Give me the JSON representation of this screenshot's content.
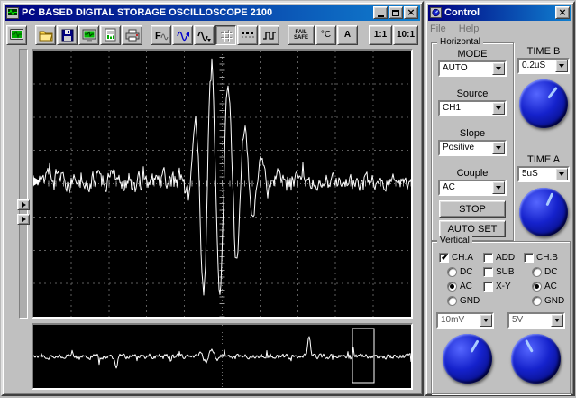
{
  "colors": {
    "titlebar_left": "#000080",
    "titlebar_right": "#1080d0",
    "chrome": "#c0c0c0",
    "scope_bg": "#000000",
    "grid": "#5e5e5e",
    "trace": "#ffffff",
    "knob_blue": "#1522cc"
  },
  "main_window": {
    "title": "PC BASED DIGITAL STORAGE OSCILLOSCOPE 2100",
    "toolbar": {
      "failsafe1": "FAIL",
      "failsafe2": "SAFE",
      "celsius": "°C",
      "ampere": "A",
      "ratio11": "1:1",
      "ratio101": "10:1"
    }
  },
  "control_window": {
    "title": "Control",
    "menu": {
      "file": "File",
      "help": "Help"
    },
    "horizontal": {
      "title": "Horizontal",
      "mode_label": "MODE",
      "mode_value": "AUTO",
      "source_label": "Source",
      "source_value": "CH1",
      "slope_label": "Slope",
      "slope_value": "Positive",
      "couple_label": "Couple",
      "couple_value": "AC",
      "stop": "STOP",
      "auto_set": "AUTO SET"
    },
    "time_b": {
      "label": "TIME B",
      "value": "0.2uS"
    },
    "time_a": {
      "label": "TIME A",
      "value": "5uS"
    },
    "vertical": {
      "title": "Vertical",
      "cha": {
        "label": "CH.A",
        "checked": true,
        "dc": "DC",
        "ac": "AC",
        "gnd": "GND",
        "coupling_selected": "AC",
        "volts": "10mV"
      },
      "mid": {
        "add": "ADD",
        "sub": "SUB",
        "xy": "X-Y"
      },
      "chb": {
        "label": "CH.B",
        "checked": false,
        "dc": "DC",
        "ac": "AC",
        "gnd": "GND",
        "coupling_selected": "AC",
        "volts": "5V"
      }
    }
  },
  "waveform": {
    "seed": 1337,
    "burst_center_frac": 0.465,
    "burst_amp": 142,
    "pre_noise": 10.5,
    "post_noise": 7.5,
    "mini_seed": 93,
    "mini_spike_frac": 0.73,
    "zoom_window_frac": 0.845
  }
}
